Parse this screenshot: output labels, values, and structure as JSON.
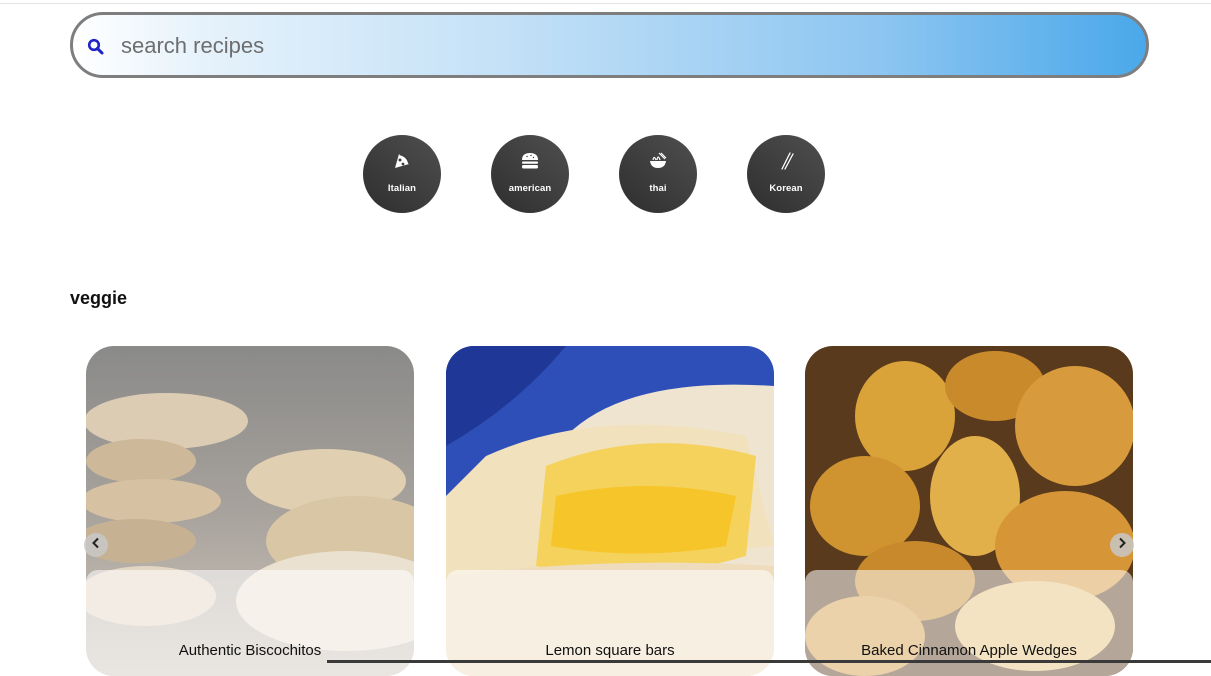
{
  "search": {
    "placeholder": "search recipes",
    "icon": "search-icon"
  },
  "cuisines": [
    {
      "label": "Italian",
      "icon": "pizza-icon"
    },
    {
      "label": "american",
      "icon": "burger-icon"
    },
    {
      "label": "thai",
      "icon": "noodle-bowl-icon"
    },
    {
      "label": "Korean",
      "icon": "chopsticks-icon"
    }
  ],
  "section": {
    "title": "veggie"
  },
  "cards": [
    {
      "title": "Authentic Biscochitos"
    },
    {
      "title": "Lemon square bars"
    },
    {
      "title": "Baked Cinnamon Apple Wedges"
    }
  ],
  "carousel": {
    "prev_icon": "chevron-left-icon",
    "next_icon": "chevron-right-icon"
  },
  "colors": {
    "search_gradient_end": "#4aa8ea",
    "cuisine_circle": "#3c3c3c"
  }
}
